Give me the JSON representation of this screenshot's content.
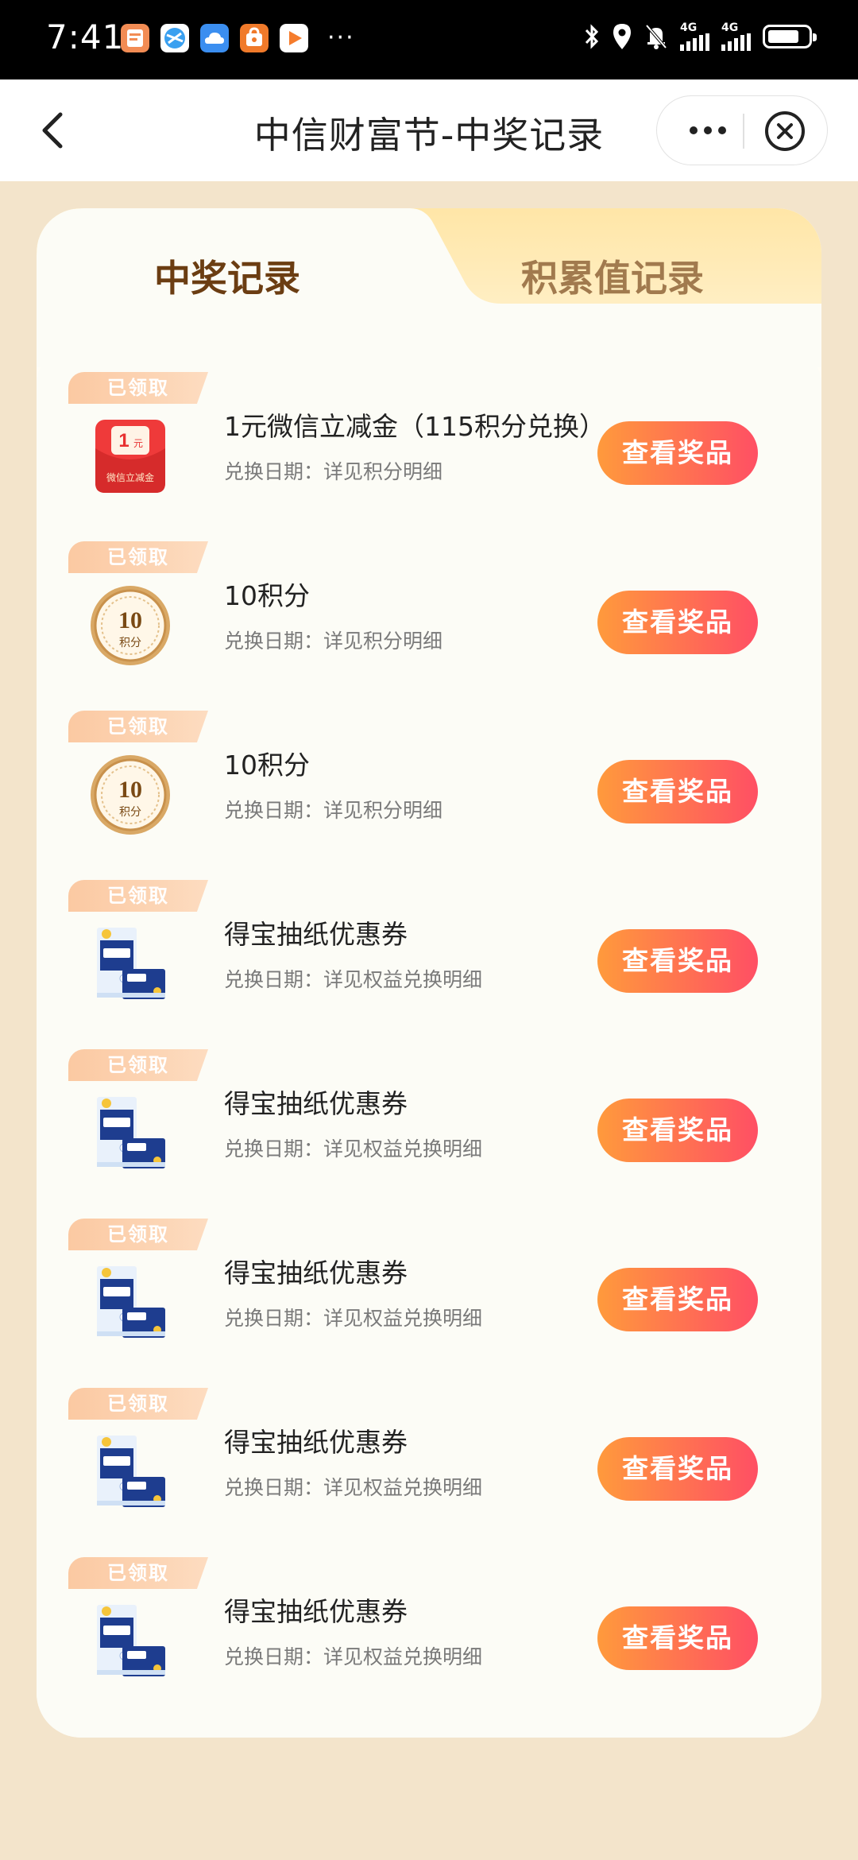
{
  "status_bar": {
    "time": "7:41",
    "apps": [
      {
        "icon": "notes-app-icon",
        "color": "#f28c54"
      },
      {
        "icon": "browser-app-icon",
        "color": "#3aa0f0"
      },
      {
        "icon": "cloud-app-icon",
        "color": "#3b8ef0"
      },
      {
        "icon": "shop-app-icon",
        "color": "#f07a2a"
      },
      {
        "icon": "video-app-icon",
        "color": "#f57c2c"
      }
    ],
    "more": "···",
    "signal1_label": "4G",
    "signal2_label": "4G"
  },
  "nav": {
    "title": "中信财富节-中奖记录"
  },
  "tabs": [
    {
      "label": "中奖记录",
      "active": true
    },
    {
      "label": "积累值记录",
      "active": false
    }
  ],
  "colors": {
    "accent_start": "#ff9a3c",
    "accent_end": "#ff4f64",
    "page_bg": "#f3e4cb",
    "active_tab_text": "#6b3d12",
    "inactive_tab_text": "#a17a4e"
  },
  "records": [
    {
      "badge": "已领取",
      "title": "1元微信立减金（115积分兑换）",
      "date_label": "兑换日期：",
      "date_value": "详见积分明细",
      "button": "查看奖品",
      "thumb": "red-envelope-icon",
      "thumb_text": "1元",
      "thumb_caption": "微信立减金"
    },
    {
      "badge": "已领取",
      "title": "10积分",
      "date_label": "兑换日期：",
      "date_value": "详见积分明细",
      "button": "查看奖品",
      "thumb": "points-coin-icon",
      "thumb_text": "10",
      "thumb_caption": "积分"
    },
    {
      "badge": "已领取",
      "title": "10积分",
      "date_label": "兑换日期：",
      "date_value": "详见积分明细",
      "button": "查看奖品",
      "thumb": "points-coin-icon",
      "thumb_text": "10",
      "thumb_caption": "积分"
    },
    {
      "badge": "已领取",
      "title": "得宝抽纸优惠券",
      "date_label": "兑换日期：",
      "date_value": "详见权益兑换明细",
      "button": "查看奖品",
      "thumb": "tissue-pack-icon"
    },
    {
      "badge": "已领取",
      "title": "得宝抽纸优惠券",
      "date_label": "兑换日期：",
      "date_value": "详见权益兑换明细",
      "button": "查看奖品",
      "thumb": "tissue-pack-icon"
    },
    {
      "badge": "已领取",
      "title": "得宝抽纸优惠券",
      "date_label": "兑换日期：",
      "date_value": "详见权益兑换明细",
      "button": "查看奖品",
      "thumb": "tissue-pack-icon"
    },
    {
      "badge": "已领取",
      "title": "得宝抽纸优惠券",
      "date_label": "兑换日期：",
      "date_value": "详见权益兑换明细",
      "button": "查看奖品",
      "thumb": "tissue-pack-icon"
    },
    {
      "badge": "已领取",
      "title": "得宝抽纸优惠券",
      "date_label": "兑换日期：",
      "date_value": "详见权益兑换明细",
      "button": "查看奖品",
      "thumb": "tissue-pack-icon"
    }
  ]
}
